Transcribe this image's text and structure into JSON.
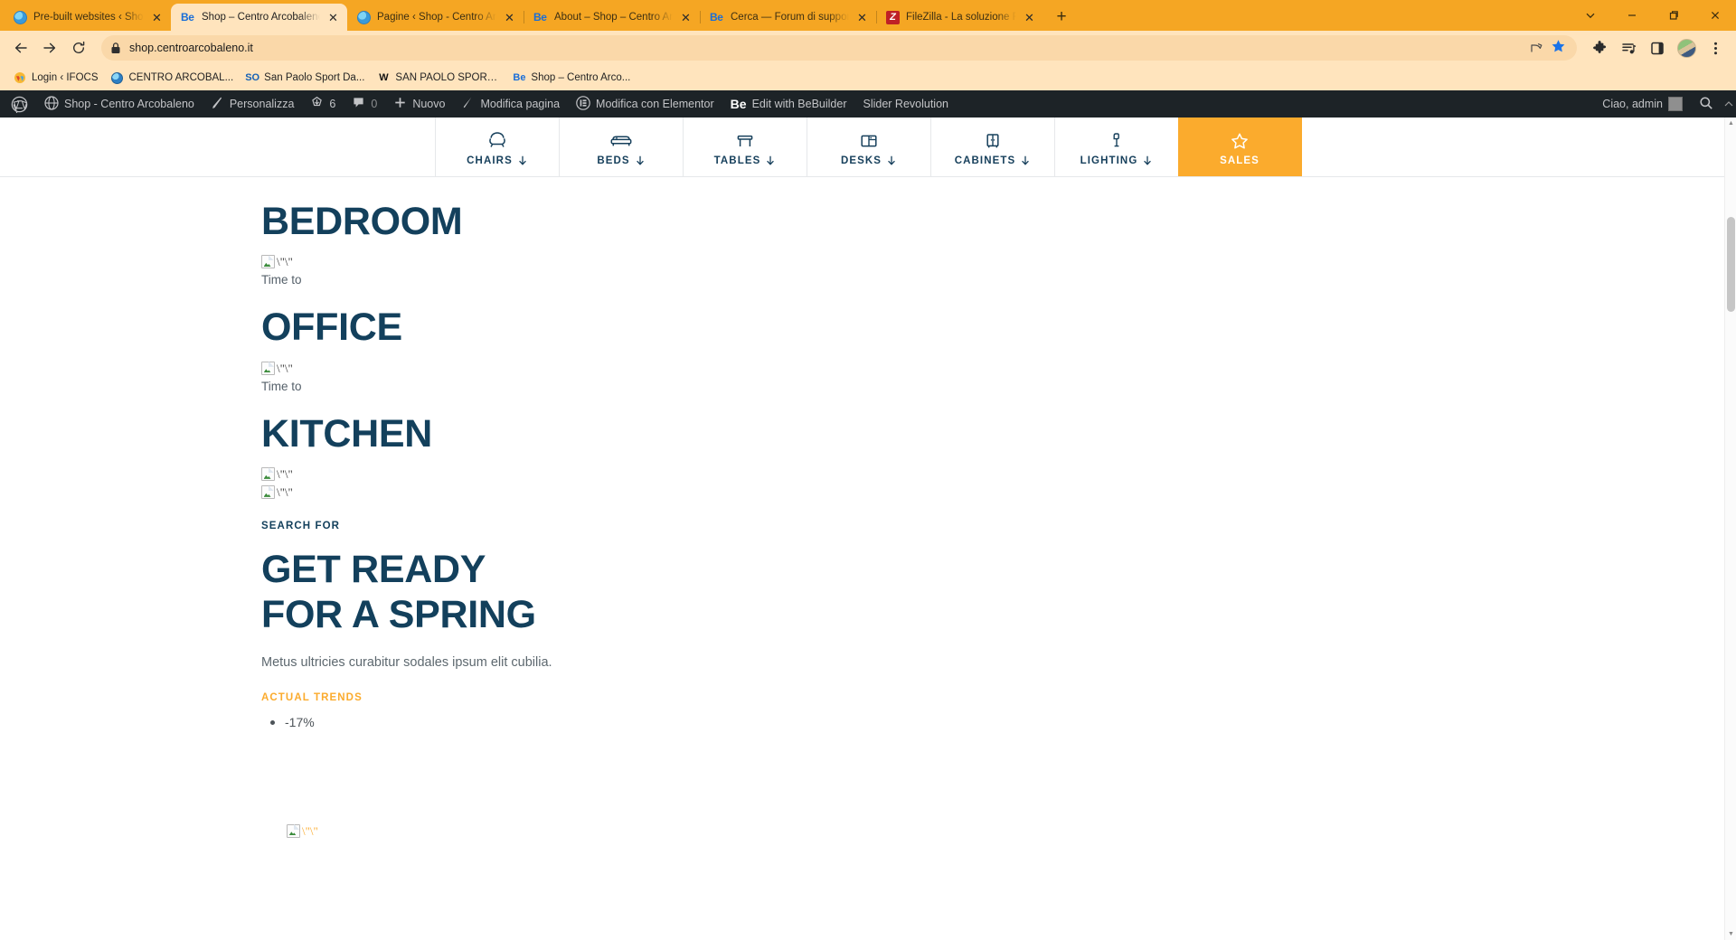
{
  "browser": {
    "tabs": [
      {
        "title": "Pre-built websites ‹ Shop - Centro",
        "favicon": "globe-icon",
        "active": false
      },
      {
        "title": "Shop – Centro Arcobaleno",
        "favicon": "bebuilder-icon",
        "active": true
      },
      {
        "title": "Pagine ‹ Shop - Centro Arcobaleno",
        "favicon": "globe-icon",
        "active": false
      },
      {
        "title": "About – Shop – Centro Arcobaleno",
        "favicon": "bebuilder-icon",
        "active": false
      },
      {
        "title": "Cerca — Forum di supporto di Be",
        "favicon": "bebuilder-icon",
        "active": false
      },
      {
        "title": "FileZilla - La soluzione FTP gratuita",
        "favicon": "filezilla-icon",
        "active": false
      }
    ],
    "new_tab_label": "+",
    "window_controls": [
      "chevron-down",
      "minimize",
      "maximize",
      "close"
    ],
    "address": "shop.centroarcobaleno.it",
    "back_label": "←",
    "forward_label": "→",
    "reload_label": "⟳",
    "bookmarks": [
      {
        "label": "Login ‹ IFOCS",
        "icon": "wordpress-colored-icon"
      },
      {
        "label": "CENTRO ARCOBAL...",
        "icon": "globe-icon"
      },
      {
        "label": "San Paolo Sport Da...",
        "icon": "so-icon"
      },
      {
        "label": "SAN PAOLO SPORT...",
        "icon": "w-icon"
      },
      {
        "label": "Shop – Centro Arco...",
        "icon": "bebuilder-icon"
      }
    ]
  },
  "wp_admin_bar": {
    "items": [
      {
        "label": "",
        "icon": "wordpress-logo-icon"
      },
      {
        "label": "Shop - Centro Arcobaleno",
        "icon": "site-icon"
      },
      {
        "label": "Personalizza",
        "icon": "pencil-icon"
      },
      {
        "label": "6",
        "icon": "updates-icon"
      },
      {
        "label": "0",
        "icon": "comment-icon"
      },
      {
        "label": "Nuovo",
        "icon": "plus-icon"
      },
      {
        "label": "Modifica pagina",
        "icon": "edit-icon"
      },
      {
        "label": "Modifica con Elementor",
        "icon": "elementor-icon"
      },
      {
        "label": "Edit with BeBuilder",
        "icon": "bebuilder-icon"
      },
      {
        "label": "Slider Revolution",
        "icon": "none"
      }
    ],
    "greeting": "Ciao, admin",
    "search_icon": "search-icon",
    "avatar": "user-avatar"
  },
  "site_nav": [
    {
      "label": "CHAIRS",
      "icon": "chair-icon",
      "has_caret": true,
      "highlight": false
    },
    {
      "label": "BEDS",
      "icon": "bed-icon",
      "has_caret": true,
      "highlight": false
    },
    {
      "label": "TABLES",
      "icon": "table-icon",
      "has_caret": true,
      "highlight": false
    },
    {
      "label": "DESKS",
      "icon": "desk-icon",
      "has_caret": true,
      "highlight": false
    },
    {
      "label": "CABINETS",
      "icon": "cabinet-icon",
      "has_caret": true,
      "highlight": false
    },
    {
      "label": "LIGHTING",
      "icon": "lamp-icon",
      "has_caret": true,
      "highlight": false
    },
    {
      "label": "SALES",
      "icon": "star-icon",
      "has_caret": false,
      "highlight": true
    }
  ],
  "page": {
    "heading_bedroom": "BEDROOM",
    "heading_office": "OFFICE",
    "heading_kitchen": "KITCHEN",
    "broken_image_alt": "\\\"\\\"",
    "caption_1": "Time to",
    "caption_2": "Time to",
    "eyebrow_search": "SEARCH FOR",
    "hero_line_1": "GET READY",
    "hero_line_2": "FOR A SPRING",
    "hero_paragraph": "Metus ultricies curabitur sodales ipsum elit cubilia.",
    "eyebrow_trends": "ACTUAL TRENDS",
    "trends": [
      "-17%"
    ]
  },
  "colors": {
    "brand_orange": "#fbab2d",
    "navy": "#13405c",
    "chrome_orange": "#f5a623",
    "toolbar_cream": "#ffe4bd",
    "wp_bar": "#1d2327"
  }
}
